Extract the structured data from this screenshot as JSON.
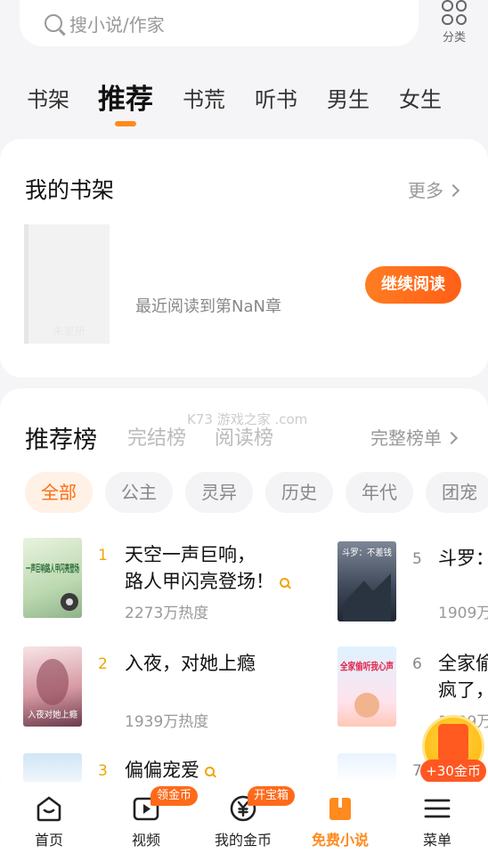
{
  "search": {
    "placeholder": "搜小说/作家"
  },
  "category": {
    "label": "分类"
  },
  "tabs": [
    "书架",
    "推荐",
    "书荒",
    "听书",
    "男生",
    "女生"
  ],
  "shelf": {
    "title": "我的书架",
    "more": "更多",
    "placeholder_text": "未更新",
    "last_read": "最近阅读到第NaN章",
    "continue_label": "继续阅读"
  },
  "ranking": {
    "tabs": [
      "推荐榜",
      "完结榜",
      "阅读榜"
    ],
    "full_list": "完整榜单",
    "watermark": "K73 游戏之家 .com",
    "chips": [
      "全部",
      "公主",
      "灵异",
      "历史",
      "年代",
      "团宠"
    ],
    "items": [
      {
        "rank": "1",
        "title_line1": "天空一声巨响，",
        "title_line2": "路人甲闪亮登场！",
        "heat": "2273万热度",
        "cover_text": "一声巨响路人甲闪亮登场"
      },
      {
        "rank": "2",
        "title_line1": "入夜，对她上瘾",
        "heat": "1939万热度",
        "cover_text": "入夜对她上瘾"
      },
      {
        "rank": "3",
        "title_line1": "偏偏宠爱"
      },
      {
        "rank": "5",
        "title_line1": "斗罗：",
        "heat": "1909万",
        "cover_text": "斗罗：不差钱"
      },
      {
        "rank": "6",
        "title_line1": "全家偷",
        "title_line2": "疯了，",
        "heat": "1899万",
        "cover_text": "全家偷听我心声"
      },
      {
        "rank": "7"
      }
    ]
  },
  "coin_float": {
    "label": "+30金币"
  },
  "nav": [
    {
      "label": "首页"
    },
    {
      "label": "视频",
      "badge": "领金币"
    },
    {
      "label": "我的金币",
      "badge": "开宝箱"
    },
    {
      "label": "免费小说"
    },
    {
      "label": "菜单"
    }
  ],
  "colors": {
    "accent": "#ff8a1e",
    "rank_gold": "#f0a500",
    "button": "#ff6a1a"
  }
}
